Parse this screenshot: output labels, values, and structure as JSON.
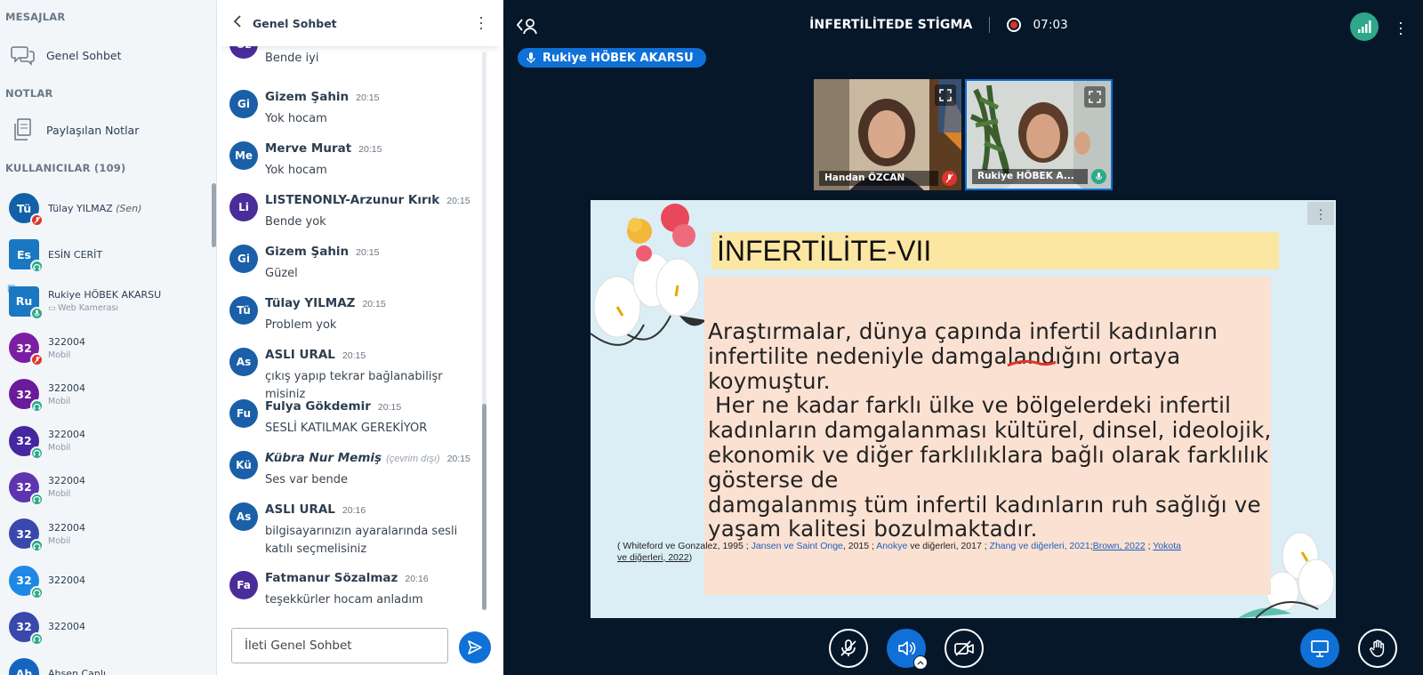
{
  "sidebar": {
    "messages_title": "MESAJLAR",
    "public_chat_label": "Genel Sohbet",
    "notes_title": "NOTLAR",
    "shared_notes_label": "Paylaşılan Notlar",
    "users_title": "KULLANICILAR (109)",
    "users": [
      {
        "initials": "Tü",
        "name": "Tülay YILMAZ",
        "you": "(Sen)",
        "sub": "",
        "color": "#1160a8",
        "badge": "muted",
        "square": false
      },
      {
        "initials": "Es",
        "name": "ESİN CERİT",
        "you": "",
        "sub": "",
        "color": "#1a78c2",
        "badge": "listen",
        "square": true
      },
      {
        "initials": "Ru",
        "name": "Rukiye HÖBEK AKARSU",
        "you": "",
        "sub": "Web Kamerası",
        "color": "#1a78c2",
        "badge": "mic",
        "square": true
      },
      {
        "initials": "32",
        "name": "322004",
        "you": "",
        "sub": "Mobil",
        "color": "#7b1fa2",
        "badge": "muted",
        "square": false
      },
      {
        "initials": "32",
        "name": "322004",
        "you": "",
        "sub": "Mobil",
        "color": "#6a1b9a",
        "badge": "listen",
        "square": false
      },
      {
        "initials": "32",
        "name": "322004",
        "you": "",
        "sub": "Mobil",
        "color": "#4527a0",
        "badge": "listen",
        "square": false
      },
      {
        "initials": "32",
        "name": "322004",
        "you": "",
        "sub": "Mobil",
        "color": "#5e35b1",
        "badge": "listen",
        "square": false
      },
      {
        "initials": "32",
        "name": "322004",
        "you": "",
        "sub": "Mobil",
        "color": "#3949ab",
        "badge": "listen",
        "square": false
      },
      {
        "initials": "32",
        "name": "322004",
        "you": "",
        "sub": "",
        "color": "#1e88e5",
        "badge": "listen",
        "square": false
      },
      {
        "initials": "32",
        "name": "322004",
        "you": "",
        "sub": "",
        "color": "#3949ab",
        "badge": "listen",
        "square": false
      },
      {
        "initials": "Ah",
        "name": "Ahsen Canlı",
        "you": "",
        "sub": "",
        "color": "#1565c0",
        "badge": "",
        "square": false
      }
    ]
  },
  "chat": {
    "title": "Genel Sohbet",
    "partial_text": "Bende iyi",
    "partial_initials": "Öz",
    "messages": [
      {
        "initials": "Gi",
        "color": "#1a5fa8",
        "name": "Gizem Şahin",
        "offline": "",
        "time": "20:15",
        "text": "Yok hocam"
      },
      {
        "initials": "Me",
        "color": "#1a5fa8",
        "name": "Merve Murat",
        "offline": "",
        "time": "20:15",
        "text": "Yok hocam"
      },
      {
        "initials": "Li",
        "color": "#4a2c9a",
        "name": "LISTENONLY-Arzunur Kırık",
        "offline": "",
        "time": "20:15",
        "text": "Bende yok"
      },
      {
        "initials": "Gi",
        "color": "#1a5fa8",
        "name": "Gizem Şahin",
        "offline": "",
        "time": "20:15",
        "text": "Güzel"
      },
      {
        "initials": "Tü",
        "color": "#1a5fa8",
        "name": "Tülay YILMAZ",
        "offline": "",
        "time": "20:15",
        "text": "Problem yok"
      },
      {
        "initials": "As",
        "color": "#1a5fa8",
        "name": "ASLI URAL",
        "offline": "",
        "time": "20:15",
        "text": "çıkış yapıp tekrar bağlanabilişr misiniz"
      },
      {
        "initials": "Fu",
        "color": "#1a5fa8",
        "name": "Fulya Gökdemir",
        "offline": "",
        "time": "20:15",
        "text": "SESLİ KATILMAK GEREKİYOR"
      },
      {
        "initials": "Kü",
        "color": "#1a5fa8",
        "name": "Kübra Nur Memiş",
        "offline": "(çevrim dışı)",
        "time": "20:15",
        "text": "Ses var bende"
      },
      {
        "initials": "As",
        "color": "#1a5fa8",
        "name": "ASLI URAL",
        "offline": "",
        "time": "20:16",
        "text": "bilgisayarınızın ayaralarında sesli katılı seçmelisiniz"
      },
      {
        "initials": "Fa",
        "color": "#4a2c9a",
        "name": "Fatmanur Sözalmaz",
        "offline": "",
        "time": "20:16",
        "text": "teşekkürler hocam anladım"
      }
    ],
    "input_placeholder": "İleti Genel Sohbet"
  },
  "main": {
    "room_title": "İNFERTİLİTEDE STİGMA",
    "recording_time": "07:03",
    "talking_user": "Rukiye HÖBEK AKARSU",
    "videos": [
      {
        "name": "Handan ÖZCAN",
        "state": "muted"
      },
      {
        "name": "Rukiye HÖBEK A...",
        "state": "talking"
      }
    ],
    "slide": {
      "title": "İNFERTİLİTE-VII",
      "paragraph_lines": [
        "Araştırmalar, dünya çapında infertil kadınların",
        "infertilite nedeniyle damgalandığını ortaya",
        "koymuştur.",
        " Her ne kadar farklı ülke ve bölgelerdeki infertil",
        "kadınların damgalanması kültürel, dinsel, ideolojik,",
        "ekonomik ve diğer farklılıklara bağlı olarak farklılık",
        "gösterse de",
        "damgalanmış tüm infertil kadınların ruh sağlığı ve",
        "yaşam kalitesi bozulmaktadır."
      ],
      "citation": {
        "p1": "( Whiteford ve Gonzalez, 1995 ; ",
        "l1": "Jansen ve Saint Onge",
        "p2": ", 2015 ; ",
        "l2": "Anokye",
        "p3": " ve diğerleri, 2017 ; ",
        "l3": "Zhang ve diğerleri, 2021",
        "p4": ";",
        "l4": "Brown, 2022",
        "p5": " ; ",
        "l5": "Yokota",
        "l6": " ve diğerleri, 2022",
        "p6": ")"
      }
    }
  },
  "colors": {
    "accent": "#0f70d7",
    "background": "#06172a",
    "muted": "#e0332b",
    "listen": "#2da88a"
  }
}
